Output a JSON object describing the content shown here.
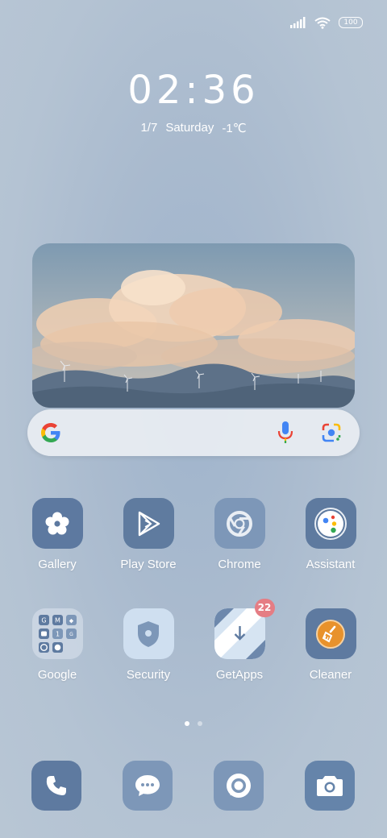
{
  "status_bar": {
    "battery": "100",
    "icons": [
      "signal-icon",
      "wifi-icon",
      "battery-icon"
    ]
  },
  "lock": {
    "time": "02:36",
    "date": "1/7",
    "day": "Saturday",
    "temperature": "-1℃"
  },
  "search": {
    "icons": [
      "google-logo",
      "mic-icon",
      "lens-icon"
    ]
  },
  "apps": [
    {
      "label": "Gallery"
    },
    {
      "label": "Play Store"
    },
    {
      "label": "Chrome"
    },
    {
      "label": "Assistant"
    },
    {
      "label": "Google"
    },
    {
      "label": "Security"
    },
    {
      "label": "GetApps",
      "badge": "22"
    },
    {
      "label": "Cleaner"
    }
  ],
  "pager": {
    "pages": 2,
    "current": 1
  },
  "dock": [
    "phone-icon",
    "messages-icon",
    "browser-icon",
    "camera-icon"
  ],
  "colors": {
    "icon_dark": "#5e7aa0",
    "icon_mid": "#7a93b6",
    "badge": "#e57d84",
    "cleaner_accent": "#e8922c"
  }
}
